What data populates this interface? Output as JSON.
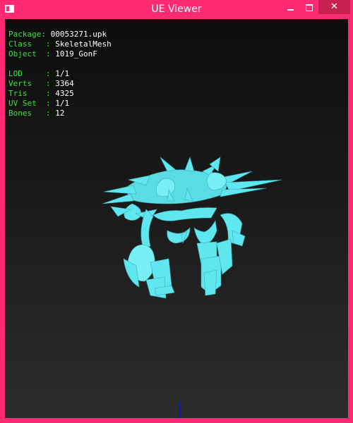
{
  "window": {
    "title": "UE Viewer",
    "controls": {
      "minimize_icon": "minimize-icon",
      "maximize_icon": "maximize-icon",
      "close_glyph": "✕"
    },
    "accent_color": "#ff2a72",
    "close_color": "#c8204f"
  },
  "info": {
    "package_label": "Package: ",
    "package_value": "00053271.upk",
    "class_label": "Class   : ",
    "class_value": "SkeletalMesh",
    "object_label": "Object  : ",
    "object_value": "1019_GonF",
    "lod_label": "LOD     : ",
    "lod_value": "1/1",
    "verts_label": "Verts   : ",
    "verts_value": "3364",
    "tris_label": "Tris    : ",
    "tris_value": "4325",
    "uvset_label": "UV Set  : ",
    "uvset_value": "1/1",
    "bones_label": "Bones   : ",
    "bones_value": "12",
    "label_color": "#3be33b",
    "value_color": "#ffffff"
  },
  "scene": {
    "mesh_color": "#5fe6ee",
    "axis_color": "#0b16c8"
  }
}
